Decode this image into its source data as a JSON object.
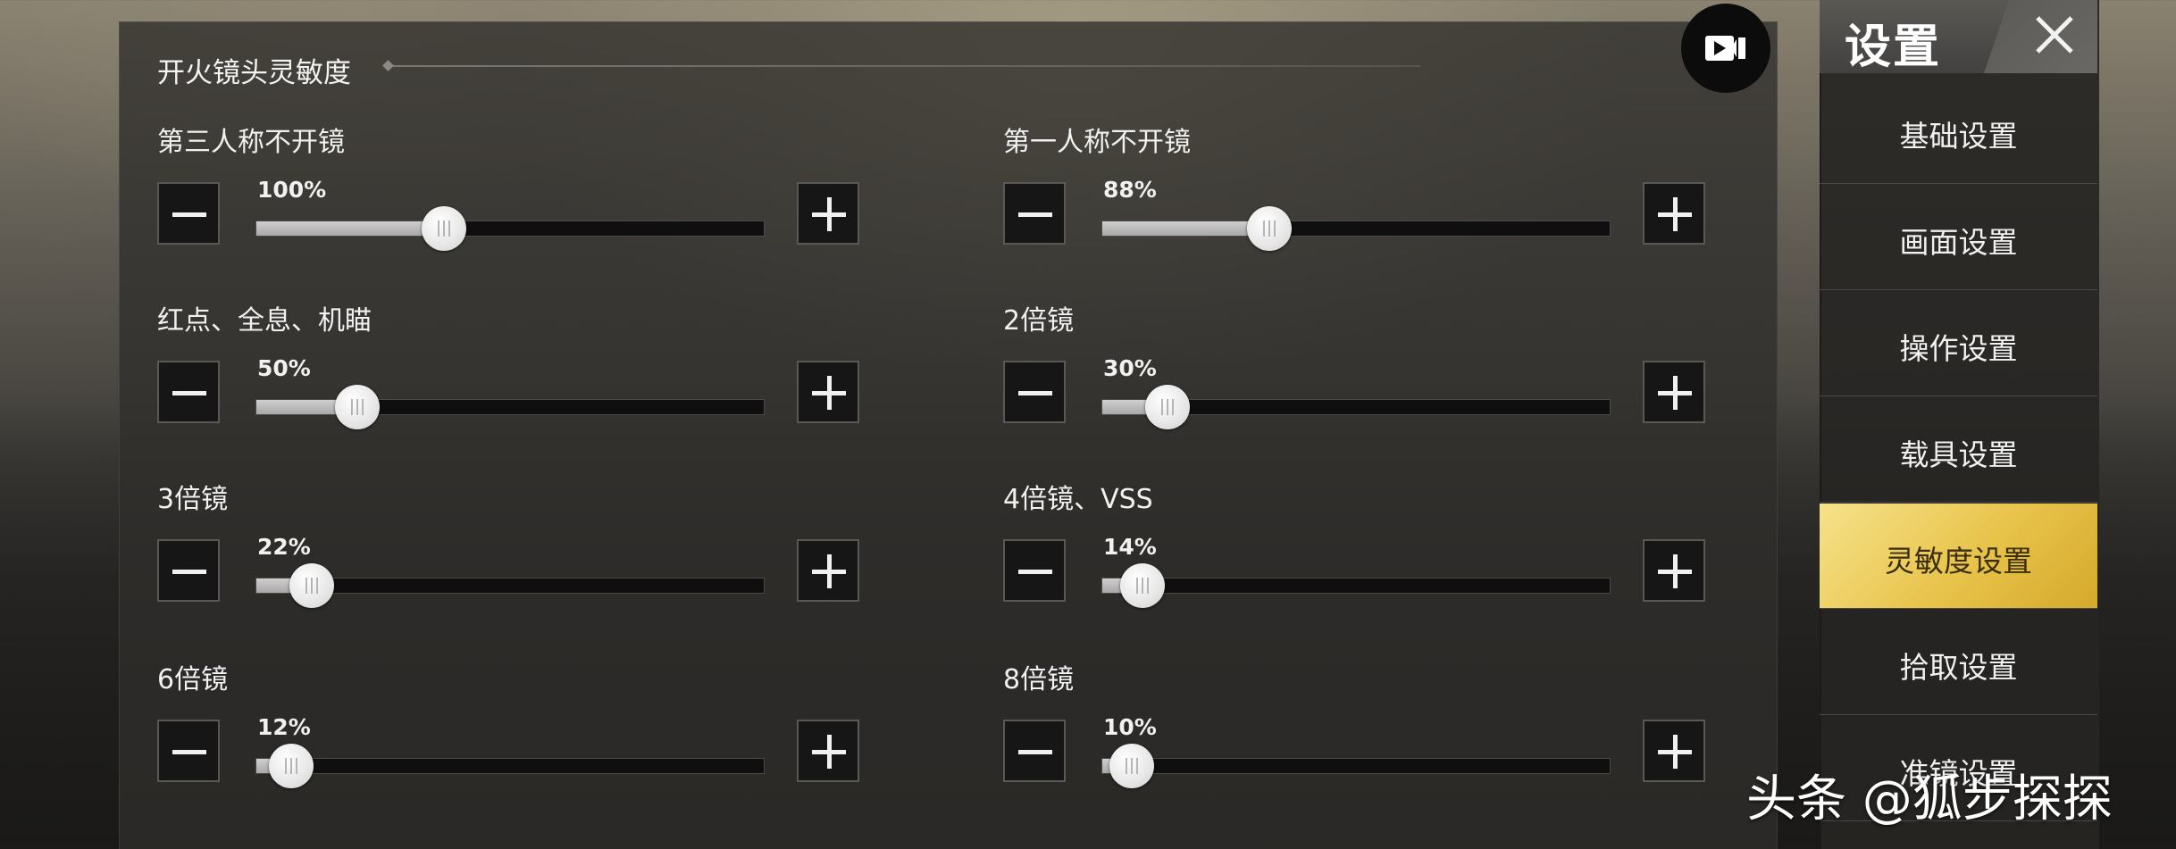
{
  "section_title": "开火镜头灵敏度",
  "settings": [
    {
      "label": "第三人称不开镜",
      "value_text": "100%",
      "fraction": 0.33
    },
    {
      "label": "第一人称不开镜",
      "value_text": "88%",
      "fraction": 0.29
    },
    {
      "label": "红点、全息、机瞄",
      "value_text": "50%",
      "fraction": 0.16
    },
    {
      "label": "2倍镜",
      "value_text": "30%",
      "fraction": 0.09
    },
    {
      "label": "3倍镜",
      "value_text": "22%",
      "fraction": 0.07
    },
    {
      "label": "4倍镜、VSS",
      "value_text": "14%",
      "fraction": 0.04
    },
    {
      "label": "6倍镜",
      "value_text": "12%",
      "fraction": 0.03
    },
    {
      "label": "8倍镜",
      "value_text": "10%",
      "fraction": 0.02
    }
  ],
  "nav": {
    "title": "设置",
    "items": [
      {
        "label": "基础设置"
      },
      {
        "label": "画面设置"
      },
      {
        "label": "操作设置"
      },
      {
        "label": "载具设置"
      },
      {
        "label": "灵敏度设置"
      },
      {
        "label": "拾取设置"
      },
      {
        "label": "准镜设置"
      }
    ],
    "active_index": 4
  },
  "watermark": "头条 @狐步探探",
  "colors": {
    "accent_gold": "#e8c34a",
    "panel_bg": "#302e2b",
    "track_fill": "#bdbdbd"
  },
  "icons": {
    "minus": "minus-icon",
    "plus": "plus-icon",
    "record": "video-camera-icon",
    "close": "close-icon"
  }
}
